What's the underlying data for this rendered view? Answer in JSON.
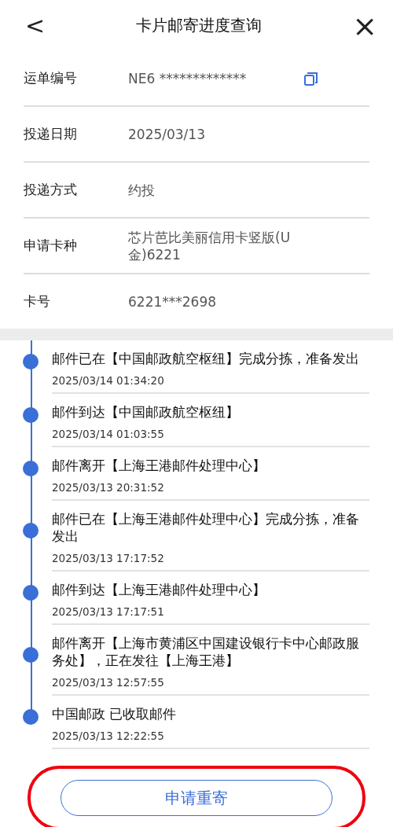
{
  "header": {
    "back": "<",
    "title": "卡片邮寄进度查询",
    "close": "×"
  },
  "details": [
    {
      "label": "运单编号",
      "value": "NE6 *************",
      "copyable": true
    },
    {
      "label": "投递日期",
      "value": "2025/03/13",
      "copyable": false
    },
    {
      "label": "投递方式",
      "value": "约投",
      "copyable": false
    },
    {
      "label": "申请卡种",
      "value": "芯片芭比美丽信用卡竖版(U金)6221",
      "copyable": false
    },
    {
      "label": "卡号",
      "value": "6221***2698",
      "copyable": false
    }
  ],
  "tracking": [
    {
      "event": "邮件已在【中国邮政航空枢纽】完成分拣，准备发出",
      "time": "2025/03/14 01:34:20"
    },
    {
      "event": "邮件到达【中国邮政航空枢纽】",
      "time": "2025/03/14 01:03:55"
    },
    {
      "event": "邮件离开【上海王港邮件处理中心】",
      "time": "2025/03/13 20:31:52"
    },
    {
      "event": "邮件已在【上海王港邮件处理中心】完成分拣，准备发出",
      "time": "2025/03/13 17:17:52"
    },
    {
      "event": "邮件到达【上海王港邮件处理中心】",
      "time": "2025/03/13 17:17:51"
    },
    {
      "event": "邮件离开【上海市黄浦区中国建设银行卡中心邮政服务处】，正在发往【上海王港】",
      "time": "2025/03/13 12:57:55"
    },
    {
      "event": "中国邮政 已收取邮件",
      "time": "2025/03/13 12:22:55"
    }
  ],
  "action_button": {
    "label": "申请重寄",
    "highlighted": true
  }
}
